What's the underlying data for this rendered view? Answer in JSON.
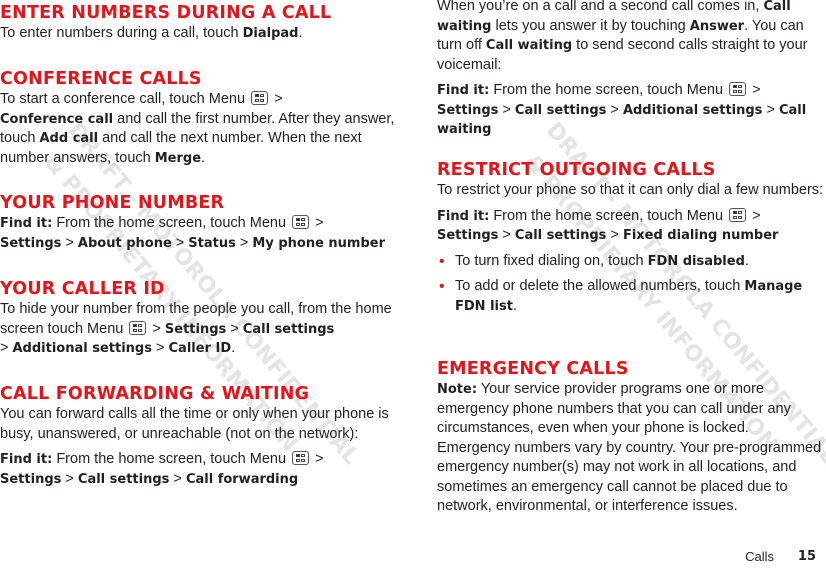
{
  "left": {
    "s1": {
      "title": "Enter numbers during a call",
      "t1": "To enter numbers during a call, touch ",
      "b1": "Dialpad",
      "t2": "."
    },
    "s2": {
      "title": "Conference calls",
      "t1": "To start a conference call, touch Menu ",
      "t2": " > ",
      "b1": "Conference call",
      "t3": " and call the first number. After they answer, touch ",
      "b2": "Add call",
      "t4": " and call the next number. When the next number answers, touch ",
      "b3": "Merge",
      "t5": "."
    },
    "s3": {
      "title": "Your phone number",
      "find": "Find it:",
      "t1": " From the home screen, touch Menu ",
      "t2": " > ",
      "b1": "Settings",
      "sep": " > ",
      "b2": "About phone",
      "b3": "Status",
      "b4": "My phone number"
    },
    "s4": {
      "title": "Your caller ID",
      "t1": "To hide your number from the people you call, from the home screen touch Menu ",
      "sep": " > ",
      "b1": "Settings",
      "b2": "Call settings",
      "b3": "Additional settings",
      "b4": "Caller ID",
      "t2": "."
    },
    "s5": {
      "title": "Call forwarding & waiting",
      "p1": "You can forward calls all the time or only when your phone is busy, unanswered, or unreachable (not on the network):",
      "find": "Find it:",
      "t1": " From the home screen, touch Menu ",
      "sep": " > ",
      "b1": "Settings",
      "b2": "Call settings",
      "b3": "Call forwarding"
    }
  },
  "right": {
    "s1": {
      "t1": "When you’re on a call and a second call comes in, ",
      "b1": "Call waiting",
      "t2": " lets you answer it by touching ",
      "b2": "Answer",
      "t3": ". You can turn off ",
      "b3": "Call waiting",
      "t4": " to send second calls straight to your voicemail:",
      "find": "Find it:",
      "t5": " From the home screen, touch Menu ",
      "sep": " > ",
      "b4": "Settings",
      "b5": "Call settings",
      "b6": "Additional settings",
      "b7": "Call waiting"
    },
    "s2": {
      "title": "Restrict outgoing calls",
      "p1": "To restrict your phone so that it can only dial a few numbers:",
      "find": "Find it:",
      "t1": " From the home screen, touch Menu ",
      "sep": " > ",
      "b1": "Settings",
      "b2": "Call settings",
      "b3": "Fixed dialing number",
      "bullets": [
        {
          "t": "To turn fixed dialing on, touch ",
          "b": "FDN disabled",
          "e": "."
        },
        {
          "t": "To add or delete the allowed numbers, touch ",
          "b": "Manage FDN list",
          "e": "."
        }
      ]
    },
    "s3": {
      "title": "Emergency calls",
      "note": "Note:",
      "t1": " Your service provider programs one or more emergency phone numbers that you can call under any circumstances, even when your phone is locked. Emergency numbers vary by country. Your pre-programmed emergency number(s) may not work in all locations, and sometimes an emergency call cannot be placed due to network, environmental, or interference issues."
    }
  },
  "watermark": {
    "line1": "DRAFT - MOTOROLA CONFIDENTIAL",
    "line2": "& PROPRIETARY INFORMATION"
  },
  "footer": {
    "section": "Calls",
    "page": "15"
  },
  "colors": {
    "heading": "#e4141b",
    "text": "#231f20"
  }
}
